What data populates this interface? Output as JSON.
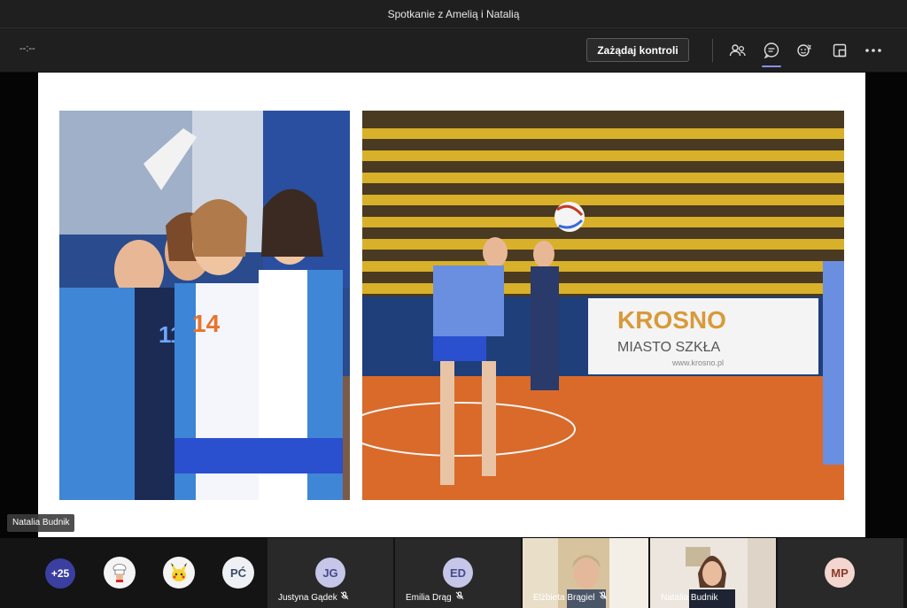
{
  "window": {
    "title": "Spotkanie z Amelią i Natalią"
  },
  "toolbar": {
    "timer": "--:--",
    "request_control_label": "Zażądaj kontroli",
    "icons": [
      "people-icon",
      "chat-icon",
      "reactions-icon",
      "view-icon",
      "more-icon"
    ]
  },
  "stage": {
    "speaker_name": "Natalia Budnik",
    "slide_banner_text": "KROSNO",
    "slide_banner_sub": "MIASTO SZKŁA",
    "slide_banner_url": "www.krosno.pl"
  },
  "participants": {
    "overflow_count": "+25",
    "pc_initials": "PĆ",
    "tiles": [
      {
        "initials": "JG",
        "name": "Justyna Gądek"
      },
      {
        "initials": "ED",
        "name": "Emilia Drąg"
      },
      {
        "name": "Elżbieta Brągiel"
      },
      {
        "name": "Natalia Budnik"
      },
      {
        "initials": "MP"
      }
    ]
  },
  "colors": {
    "accent": "#8b8fe8",
    "avatar_bg": "#c5c6e8",
    "avatar_text": "#484a8a",
    "mp_bg": "#f2d6cf",
    "mp_text": "#8a3a2a"
  }
}
